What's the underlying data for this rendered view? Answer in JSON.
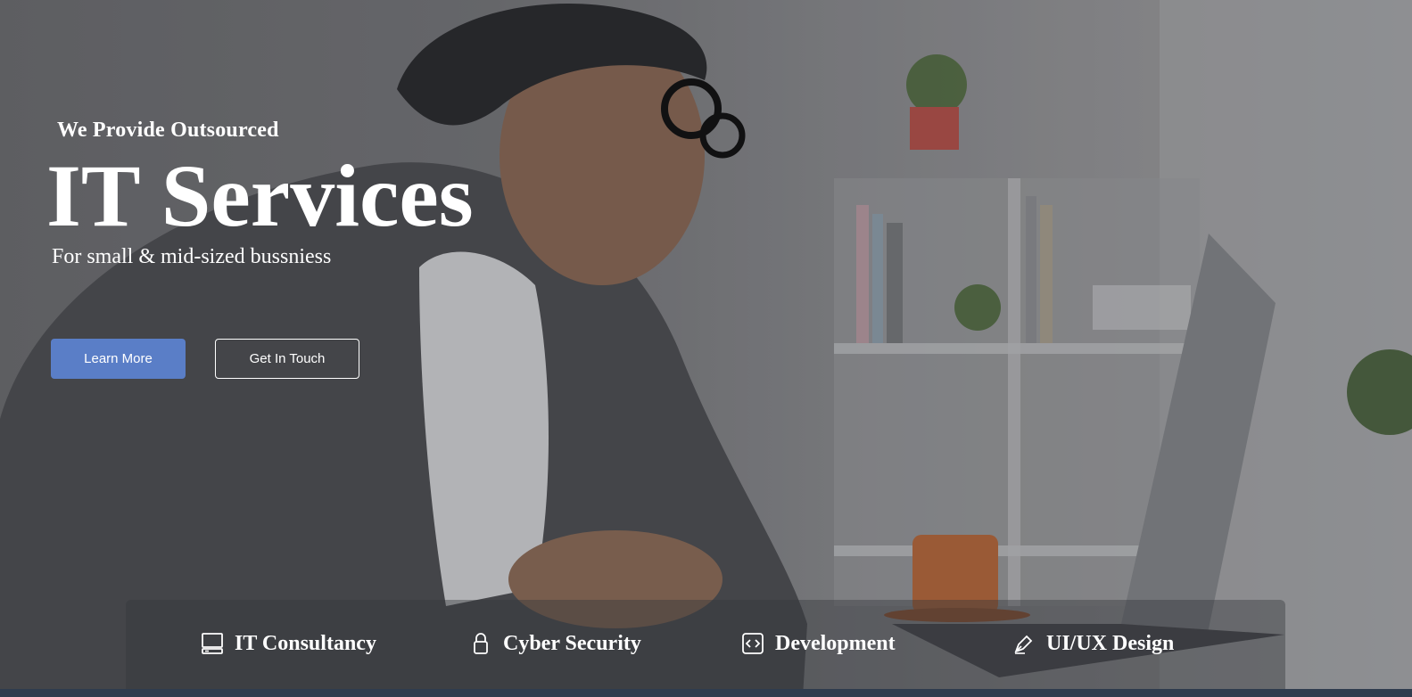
{
  "hero": {
    "tagline": "We Provide Outsourced",
    "headline": "IT Services",
    "subline": "For small & mid-sized bussniess"
  },
  "buttons": {
    "learn_more": "Learn More",
    "get_in_touch": "Get In Touch"
  },
  "services": [
    {
      "label": "IT Consultancy",
      "icon": "desktop-icon"
    },
    {
      "label": "Cyber Security",
      "icon": "lock-icon"
    },
    {
      "label": "Development",
      "icon": "code-icon"
    },
    {
      "label": "UI/UX Design",
      "icon": "pen-icon"
    }
  ],
  "colors": {
    "primary_button": "#5a7ec7",
    "bottom_strip": "#2f3c4e"
  }
}
